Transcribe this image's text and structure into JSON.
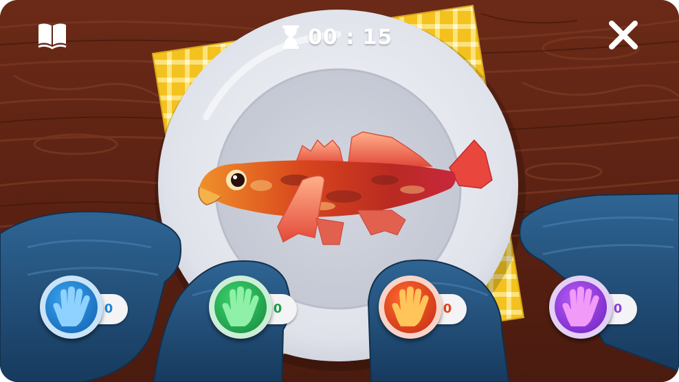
{
  "hud": {
    "timer": "00 : 15",
    "book_icon": "book-icon",
    "timer_icon": "hourglass-icon",
    "close_icon": "close-icon"
  },
  "players": [
    {
      "score": "0",
      "color": "#1a7fd6",
      "score_color": "#1f86d8"
    },
    {
      "score": "0",
      "color": "#1fa84e",
      "score_color": "#1c9e47"
    },
    {
      "score": "0",
      "color": "#e9401d",
      "score_color": "#e4421c"
    },
    {
      "score": "0",
      "color": "#9a3ee0",
      "score_color": "#9140d8"
    }
  ],
  "colors": {
    "table": "#5a2414",
    "napkin": "#f2c424",
    "plate": "#e9ebf1",
    "glove": "#23507a"
  }
}
